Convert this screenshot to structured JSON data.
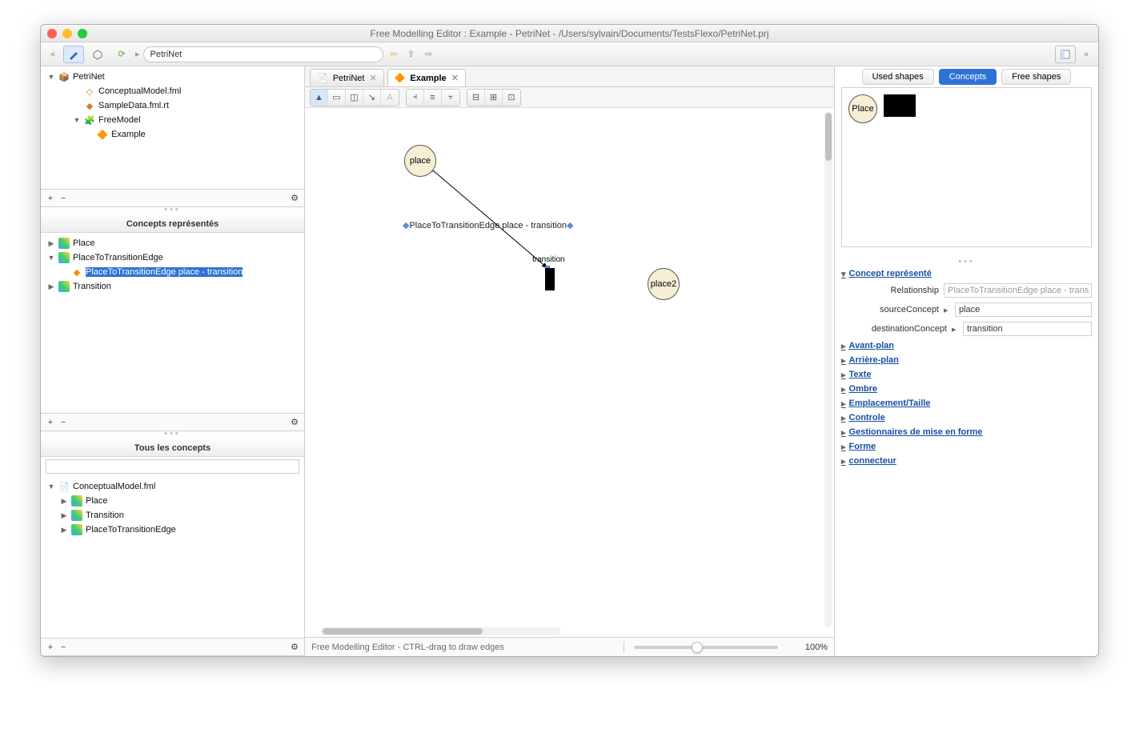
{
  "window": {
    "title": "Free Modelling Editor : Example - PetriNet - /Users/sylvain/Documents/TestsFlexo/PetriNet.prj"
  },
  "breadcrumb": {
    "value": "PetriNet"
  },
  "leftTree": {
    "root": "PetriNet",
    "items": [
      {
        "label": "ConceptualModel.fml",
        "depth": 3
      },
      {
        "label": "SampleData.fml.rt",
        "depth": 3
      },
      {
        "label": "FreeModel",
        "depth": 3,
        "expandable": true,
        "expanded": true
      },
      {
        "label": "Example",
        "depth": 4
      }
    ]
  },
  "conceptsPanel": {
    "title": "Concepts représentés",
    "items": [
      {
        "twisty": "▶",
        "label": "Place",
        "depth": 1
      },
      {
        "twisty": "▼",
        "label": "PlaceToTransitionEdge",
        "depth": 1
      },
      {
        "twisty": "",
        "label": "PlaceToTransitionEdge place - transition",
        "depth": 2,
        "selected": true
      },
      {
        "twisty": "▶",
        "label": "Transition",
        "depth": 1
      }
    ]
  },
  "allConceptsPanel": {
    "title": "Tous les concepts",
    "root": "ConceptualModel.fml",
    "items": [
      {
        "label": "Place"
      },
      {
        "label": "Transition"
      },
      {
        "label": "PlaceToTransitionEdge"
      }
    ]
  },
  "tabs": {
    "items": [
      {
        "label": "PetriNet",
        "active": false
      },
      {
        "label": "Example",
        "active": true
      }
    ]
  },
  "canvas": {
    "nodes": {
      "place1": {
        "label": "place"
      },
      "place2": {
        "label": "place2"
      },
      "transition": {
        "label": "transition"
      }
    },
    "edgeLabel": "PlaceToTransitionEdge place - transition"
  },
  "status": {
    "text": "Free Modelling Editor - CTRL-drag to draw edges",
    "zoom": "100%"
  },
  "palette": {
    "tabs": {
      "used": "Used shapes",
      "concepts": "Concepts",
      "free": "Free shapes"
    },
    "sampleLabel": "Place"
  },
  "properties": {
    "sectionTitle": "Concept représenté",
    "relationshipLabel": "Relationship",
    "relationshipValue": "PlaceToTransitionEdge place - trans",
    "sourceLabel": "sourceConcept",
    "sourceValue": "place",
    "destLabel": "destinationConcept",
    "destValue": "transition",
    "groups": [
      "Avant-plan",
      "Arrière-plan",
      "Texte",
      "Ombre",
      "Emplacement/Taille",
      "Controle",
      "Gestionnaires de mise en forme",
      "Forme",
      "connecteur"
    ]
  }
}
